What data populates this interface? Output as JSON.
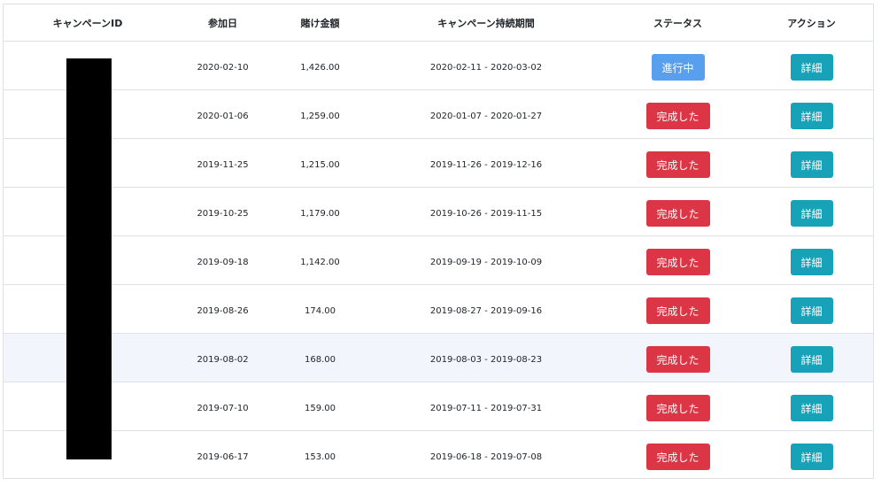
{
  "colors": {
    "in_progress": "#58a0ee",
    "completed": "#dc3545",
    "action": "#17a2b8"
  },
  "table": {
    "headers": {
      "campaign_id": "キャンペーンID",
      "join_date": "参加日",
      "bet_amount": "賭け金額",
      "period": "キャンペーン持続期間",
      "status": "ステータス",
      "action": "アクション"
    },
    "rows": [
      {
        "join_date": "2020-02-10",
        "bet_amount": "1,426.00",
        "period": "2020-02-11 - 2020-03-02",
        "status": "進行中",
        "status_type": "in_progress",
        "action": "詳細"
      },
      {
        "join_date": "2020-01-06",
        "bet_amount": "1,259.00",
        "period": "2020-01-07 - 2020-01-27",
        "status": "完成した",
        "status_type": "completed",
        "action": "詳細"
      },
      {
        "join_date": "2019-11-25",
        "bet_amount": "1,215.00",
        "period": "2019-11-26 - 2019-12-16",
        "status": "完成した",
        "status_type": "completed",
        "action": "詳細"
      },
      {
        "join_date": "2019-10-25",
        "bet_amount": "1,179.00",
        "period": "2019-10-26 - 2019-11-15",
        "status": "完成した",
        "status_type": "completed",
        "action": "詳細"
      },
      {
        "join_date": "2019-09-18",
        "bet_amount": "1,142.00",
        "period": "2019-09-19 - 2019-10-09",
        "status": "完成した",
        "status_type": "completed",
        "action": "詳細"
      },
      {
        "join_date": "2019-08-26",
        "bet_amount": "174.00",
        "period": "2019-08-27 - 2019-09-16",
        "status": "完成した",
        "status_type": "completed",
        "action": "詳細"
      },
      {
        "join_date": "2019-08-02",
        "bet_amount": "168.00",
        "period": "2019-08-03 - 2019-08-23",
        "status": "完成した",
        "status_type": "completed",
        "action": "詳細"
      },
      {
        "join_date": "2019-07-10",
        "bet_amount": "159.00",
        "period": "2019-07-11 - 2019-07-31",
        "status": "完成した",
        "status_type": "completed",
        "action": "詳細"
      },
      {
        "join_date": "2019-06-17",
        "bet_amount": "153.00",
        "period": "2019-06-18 - 2019-07-08",
        "status": "完成した",
        "status_type": "completed",
        "action": "詳細"
      }
    ]
  }
}
